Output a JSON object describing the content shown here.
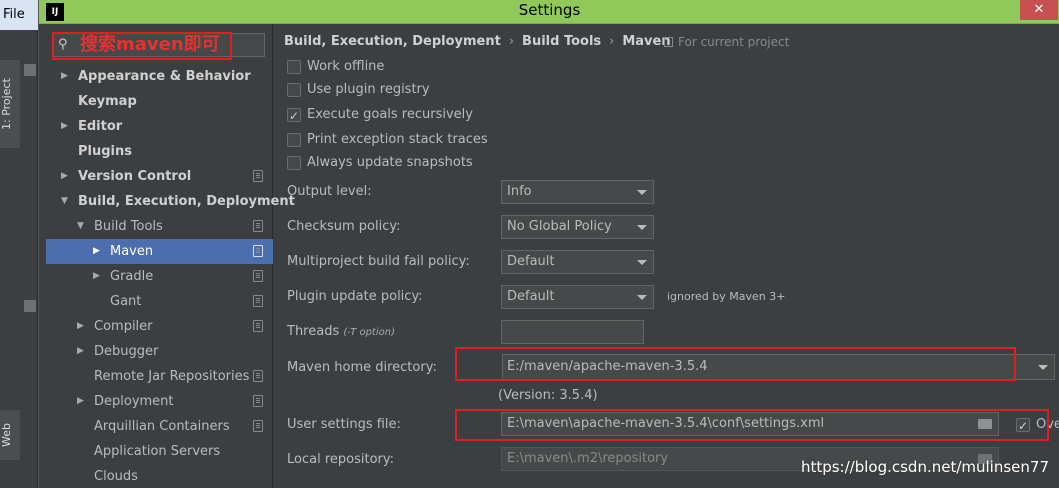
{
  "ide": {
    "file_menu": "File",
    "project_tab": "1: Project",
    "web_tab": "Web"
  },
  "window": {
    "logo": "IJ",
    "title": "Settings",
    "close": "✕"
  },
  "search": {
    "text": "搜索maven即可"
  },
  "nav": {
    "items": [
      {
        "label": "Appearance & Behavior"
      },
      {
        "label": "Keymap"
      },
      {
        "label": "Editor"
      },
      {
        "label": "Plugins"
      },
      {
        "label": "Version Control"
      },
      {
        "label": "Build, Execution, Deployment"
      },
      {
        "label": "Build Tools"
      },
      {
        "label": "Maven"
      },
      {
        "label": "Gradle"
      },
      {
        "label": "Gant"
      },
      {
        "label": "Compiler"
      },
      {
        "label": "Debugger"
      },
      {
        "label": "Remote Jar Repositories"
      },
      {
        "label": "Deployment"
      },
      {
        "label": "Arquillian Containers"
      },
      {
        "label": "Application Servers"
      },
      {
        "label": "Clouds"
      }
    ]
  },
  "breadcrumb": {
    "part1": "Build, Execution, Deployment",
    "part2": "Build Tools",
    "part3": "Maven",
    "separator": "›",
    "scope": "For current project"
  },
  "checkboxes": {
    "work_offline": "Work offline",
    "use_plugin_registry": "Use plugin registry",
    "execute_goals": "Execute goals recursively",
    "print_exception": "Print exception stack traces",
    "always_update": "Always update snapshots"
  },
  "fields": {
    "output_level_label": "Output level:",
    "output_level_value": "Info",
    "checksum_label": "Checksum policy:",
    "checksum_value": "No Global Policy",
    "multiproject_label": "Multiproject build fail policy:",
    "multiproject_value": "Default",
    "plugin_update_label": "Plugin update policy:",
    "plugin_update_value": "Default",
    "plugin_update_note": "ignored by Maven 3+",
    "threads_label": "Threads",
    "threads_hint": "(-T option)",
    "maven_home_label": "Maven home directory:",
    "maven_home_value": "E:/maven/apache-maven-3.5.4",
    "browse": "...",
    "version": "(Version: 3.5.4)",
    "user_settings_label": "User settings file:",
    "user_settings_value": "E:\\maven\\apache-maven-3.5.4\\conf\\settings.xml",
    "override_label": "Override",
    "local_repo_label": "Local repository:",
    "local_repo_value": "E:\\maven\\.m2\\repository"
  },
  "watermark": "https://blog.csdn.net/mulinsen77"
}
